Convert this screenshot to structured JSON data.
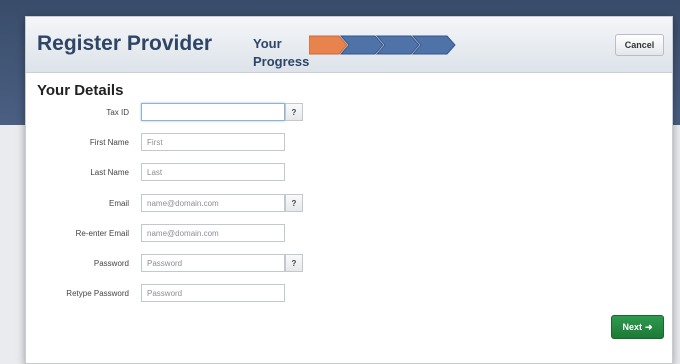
{
  "dialog": {
    "title": "Register Provider",
    "progress_label": "Your Progress",
    "progress_steps": 4,
    "progress_current": 1,
    "cancel_label": "Cancel",
    "next_label": "Next",
    "next_icon": "arrow-right-icon",
    "colors": {
      "active_step": "#e8834e",
      "inactive_step": "#4f72a8",
      "next_button": "#1f8a3e",
      "title": "#2e4566"
    }
  },
  "section": {
    "title": "Your Details"
  },
  "form": {
    "help_symbol": "?",
    "fields": [
      {
        "label": "Tax ID",
        "placeholder": "",
        "value": ""
      },
      {
        "label": "First Name",
        "placeholder": "First",
        "value": ""
      },
      {
        "label": "Last Name",
        "placeholder": "Last",
        "value": ""
      },
      {
        "label": "Email",
        "placeholder": "name@domain.com",
        "value": ""
      },
      {
        "label": "Re-enter Email",
        "placeholder": "name@domain.com",
        "value": ""
      },
      {
        "label": "Password",
        "placeholder": "Password",
        "value": ""
      },
      {
        "label": "Retype Password",
        "placeholder": "Password",
        "value": ""
      }
    ]
  }
}
